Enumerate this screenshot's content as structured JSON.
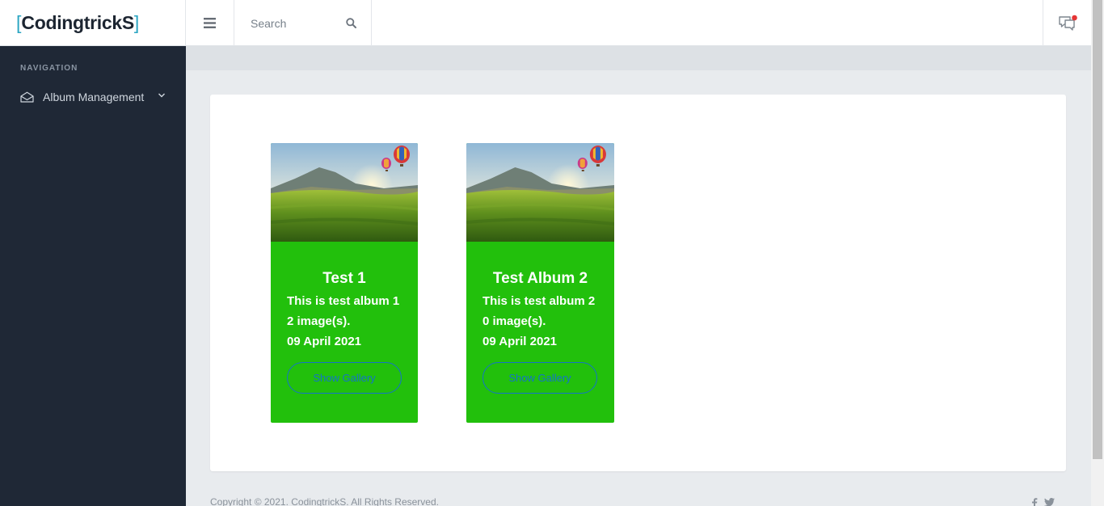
{
  "brand": {
    "bracket_open": "[",
    "name": "CodingtrickS",
    "bracket_close": "]"
  },
  "header": {
    "search": {
      "placeholder": "Search",
      "value": ""
    },
    "icons": {
      "menu": "hamburger-icon",
      "search": "search-icon",
      "notifications": "chat-notification-icon"
    }
  },
  "sidebar": {
    "heading": "NAVIGATION",
    "items": [
      {
        "label": "Album Management",
        "icon": "envelope-open-icon",
        "expand_icon": "chevron-down-icon"
      }
    ]
  },
  "albums": [
    {
      "title": "Test 1",
      "description": "This is test album 1",
      "image_count": "2 image(s).",
      "date": "09 April 2021",
      "button": "Show Gallery"
    },
    {
      "title": "Test Album 2",
      "description": "This is test album 2",
      "image_count": "0 image(s).",
      "date": "09 April 2021",
      "button": "Show Gallery"
    }
  ],
  "footer": {
    "copyright": "Copyright © 2021. CodingtrickS. All Rights Reserved.",
    "social_icons": [
      "facebook-icon",
      "twitter-icon"
    ]
  },
  "colors": {
    "sidebar": "#1f2836",
    "album_card": "#22c00c",
    "button_border": "#1473c9",
    "brand_bracket": "#2aa5c2"
  }
}
